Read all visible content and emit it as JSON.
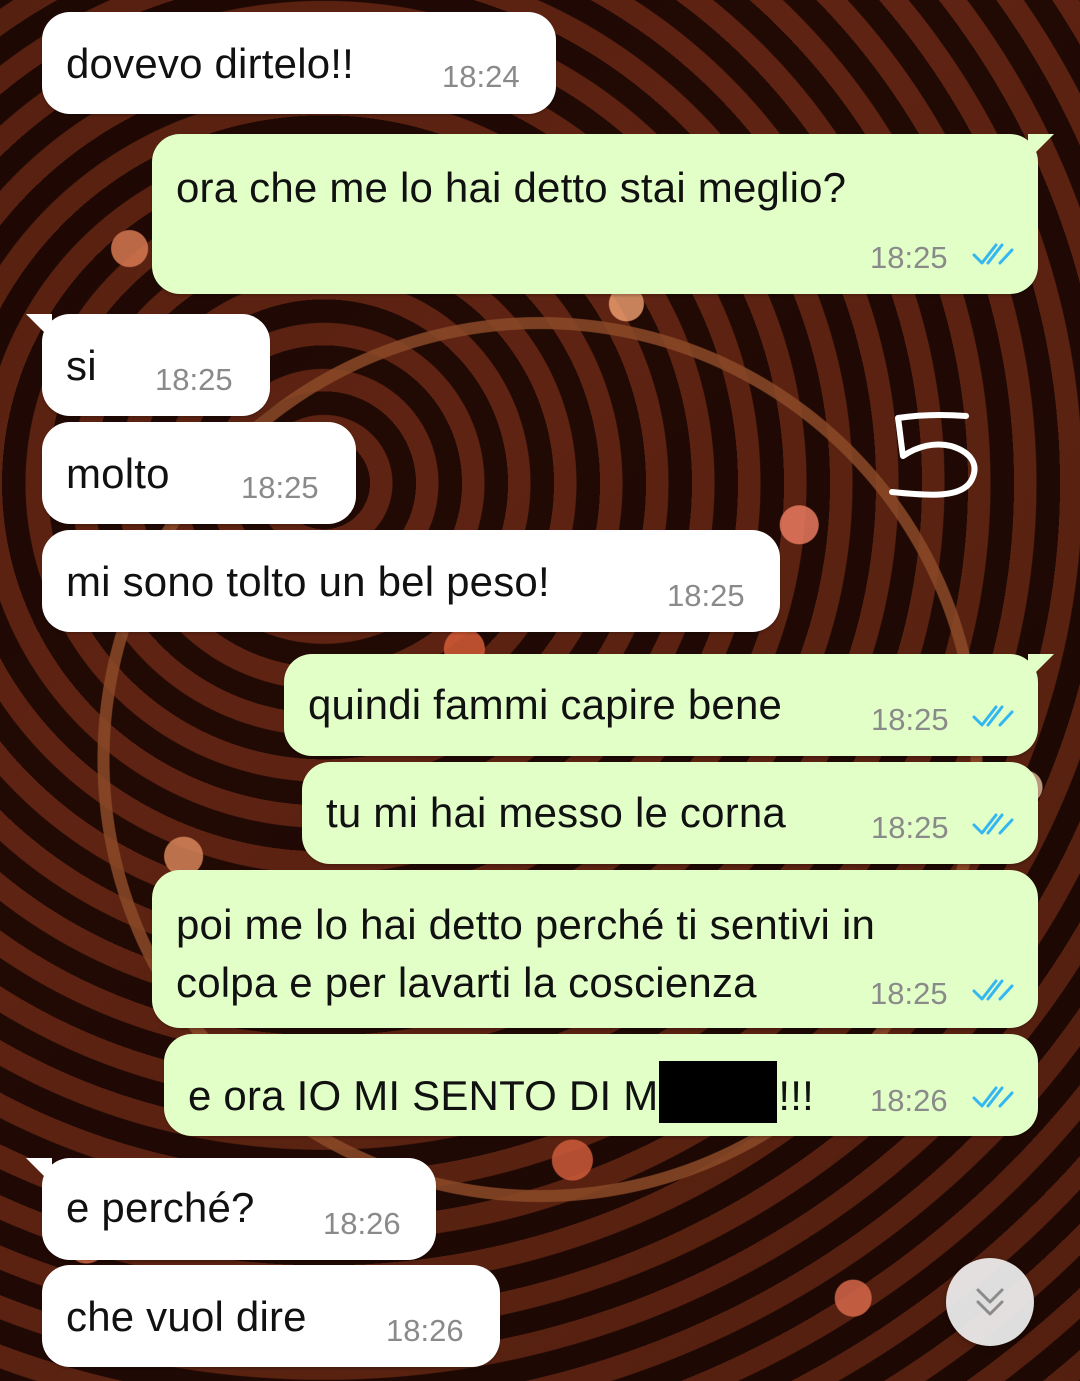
{
  "messages": [
    {
      "direction": "incoming",
      "text": "dovevo dirtelo!!",
      "time": "18:24"
    },
    {
      "direction": "outgoing",
      "text": "ora che me lo hai detto stai meglio?",
      "time": "18:25",
      "status": "read"
    },
    {
      "direction": "incoming",
      "text": "si",
      "time": "18:25"
    },
    {
      "direction": "incoming",
      "text": "molto",
      "time": "18:25"
    },
    {
      "direction": "incoming",
      "text": "mi sono tolto un bel peso!",
      "time": "18:25"
    },
    {
      "direction": "outgoing",
      "text": "quindi fammi capire bene",
      "time": "18:25",
      "status": "read"
    },
    {
      "direction": "outgoing",
      "text": "tu mi hai messo le corna",
      "time": "18:25",
      "status": "read"
    },
    {
      "direction": "outgoing",
      "text": "poi me lo hai detto perché ti sentivi in colpa e per lavarti la coscienza",
      "time": "18:25",
      "status": "read"
    },
    {
      "direction": "outgoing",
      "text_before_redaction": "e ora IO MI SENTO DI M",
      "text_after_redaction": "!!!",
      "time": "18:26",
      "status": "read"
    },
    {
      "direction": "incoming",
      "text": "e perché?",
      "time": "18:26"
    },
    {
      "direction": "incoming",
      "text": "che vuol dire",
      "time": "18:26"
    }
  ],
  "annotation": {
    "text": "5"
  },
  "colors": {
    "incoming_bubble": "#ffffff",
    "outgoing_bubble": "#e1ffc7",
    "timestamp": "#8a8a8a",
    "read_ticks": "#34b7f1"
  },
  "icons": {
    "read_receipt": "double-check-icon",
    "scroll_down": "chevron-double-down-icon"
  }
}
